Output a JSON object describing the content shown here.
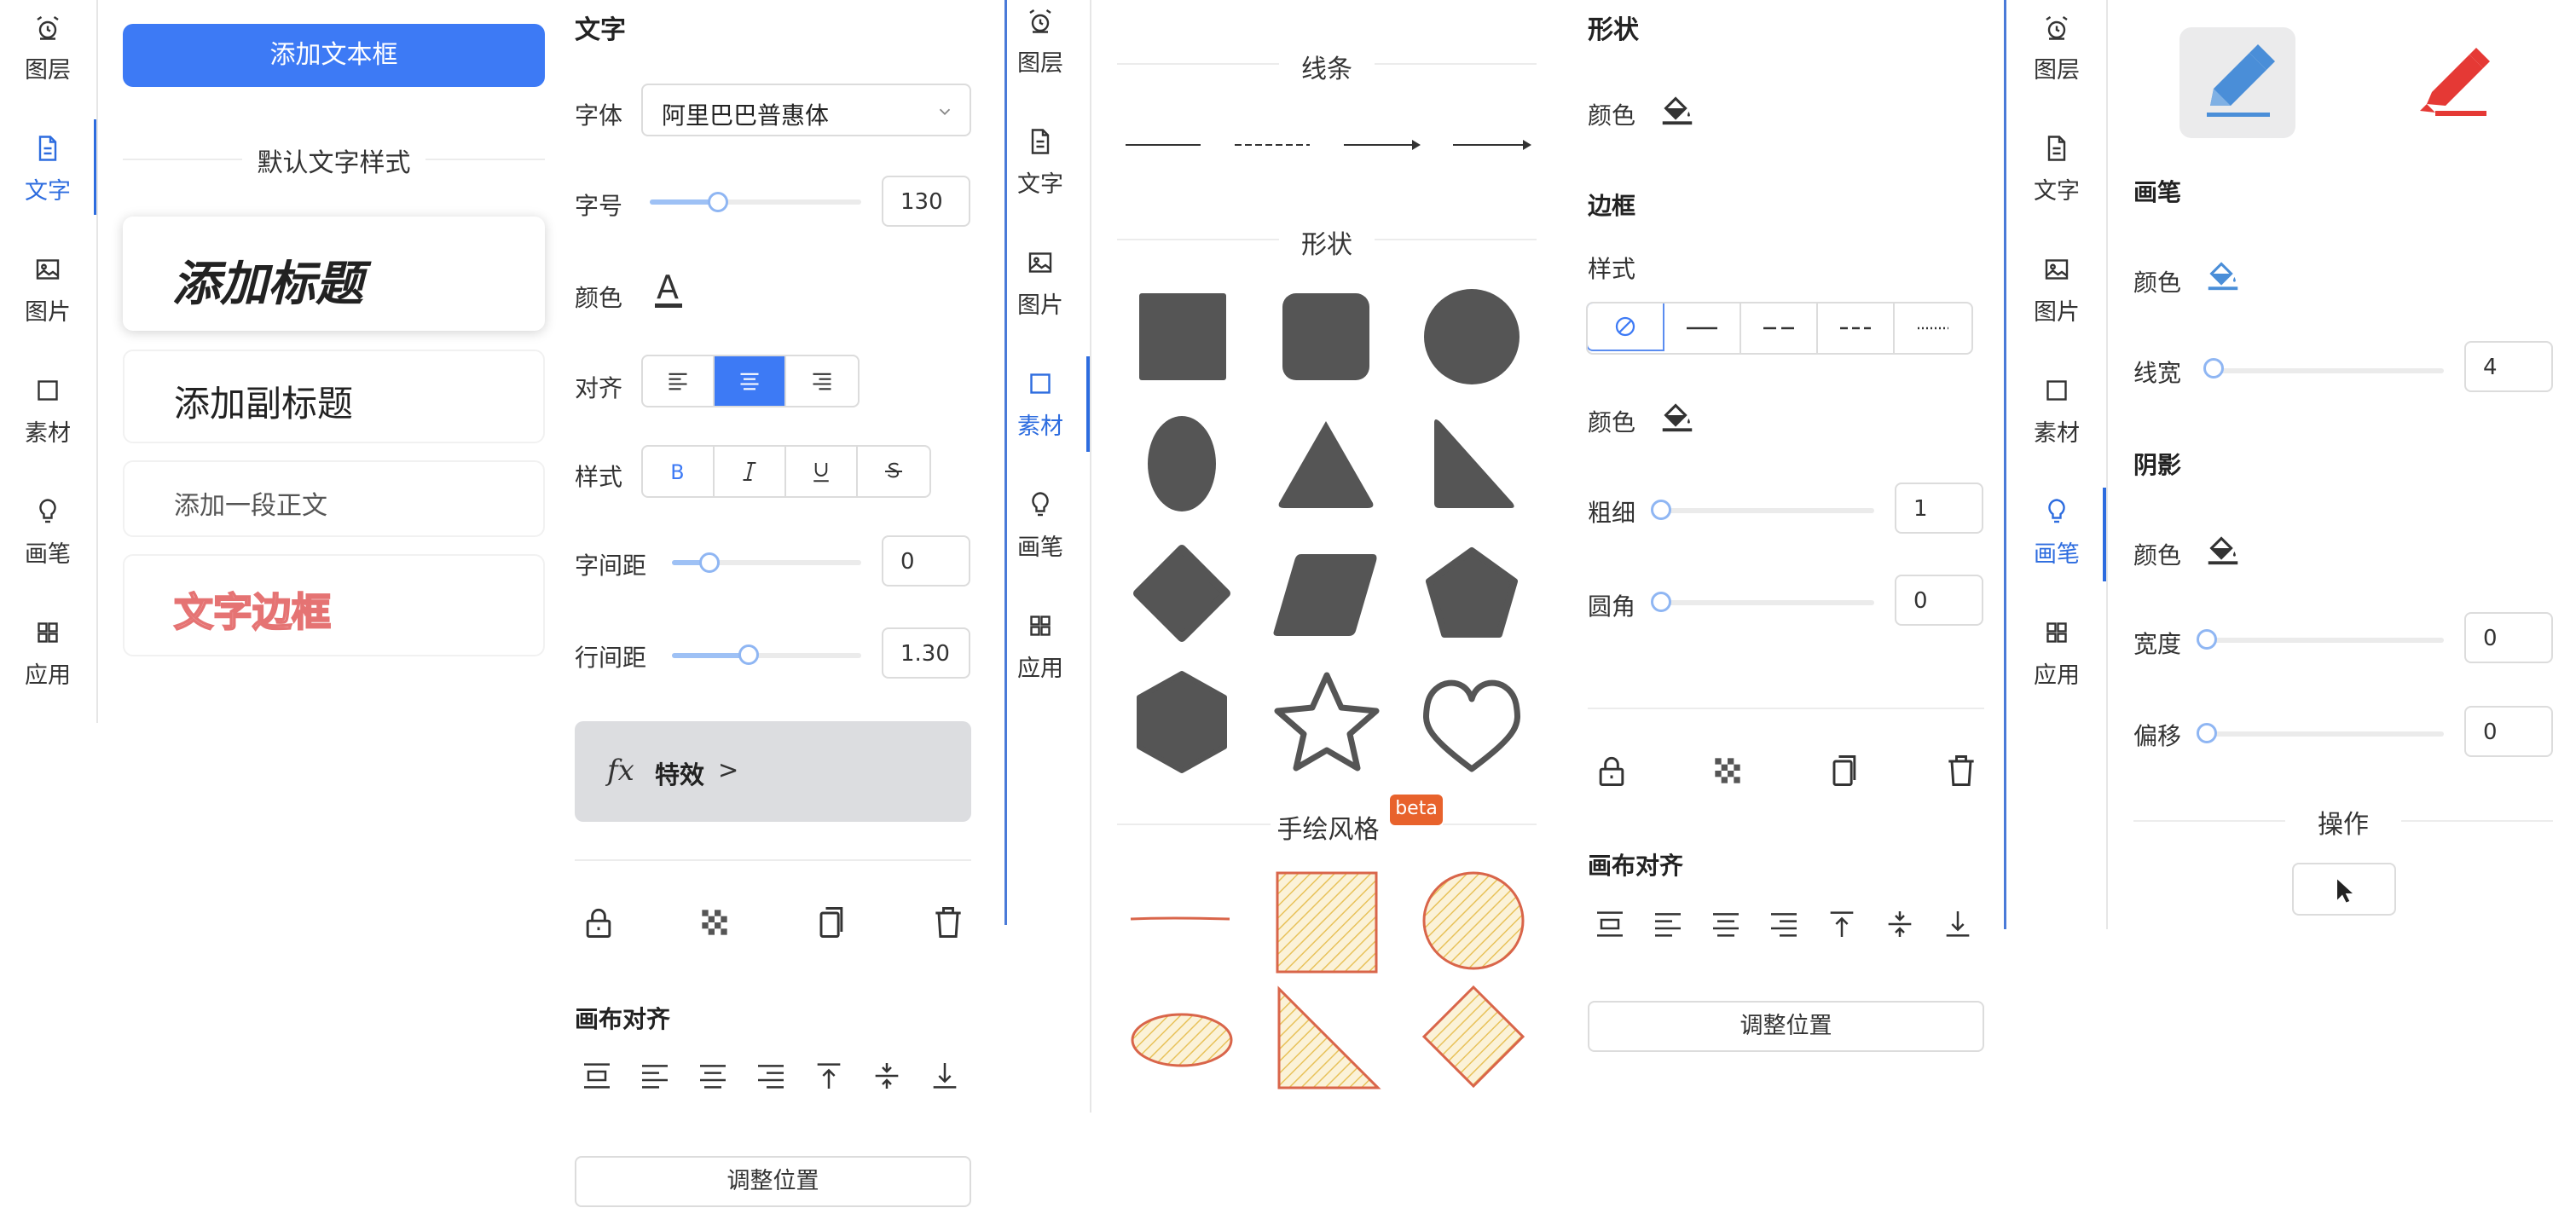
{
  "nav": {
    "items": [
      {
        "label": "图层",
        "icon": "alarm-icon"
      },
      {
        "label": "文字",
        "icon": "file-text-icon"
      },
      {
        "label": "图片",
        "icon": "image-icon"
      },
      {
        "label": "素材",
        "icon": "square-icon"
      },
      {
        "label": "画笔",
        "icon": "bulb-icon"
      },
      {
        "label": "应用",
        "icon": "apps-icon"
      }
    ]
  },
  "text_panel": {
    "add_textbox": "添加文本框",
    "default_styles": "默认文字样式",
    "add_title": "添加标题",
    "add_subtitle": "添加副标题",
    "add_body": "添加一段正文",
    "text_border": "文字边框"
  },
  "text_props": {
    "section": "文字",
    "font_label": "字体",
    "font_value": "阿里巴巴普惠体",
    "size_label": "字号",
    "size_value": "130",
    "size_fraction": 0.32,
    "color_label": "颜色",
    "align_label": "对齐",
    "style_label": "样式",
    "letter_spacing_label": "字间距",
    "letter_spacing_value": "0",
    "letter_spacing_fraction": 0.2,
    "line_height_label": "行间距",
    "line_height_value": "1.30",
    "line_height_fraction": 0.4,
    "effects_fx": "fx",
    "effects_label": "特效",
    "effects_arrow": ">",
    "canvas_align": "画布对齐",
    "adjust_position": "调整位置"
  },
  "material_panel": {
    "lines_title": "线条",
    "shapes_title": "形状",
    "handdrawn_title": "手绘风格",
    "beta": "beta"
  },
  "shape_props": {
    "section": "形状",
    "color_label": "颜色",
    "border_section": "边框",
    "style_label": "样式",
    "border_color_label": "颜色",
    "thickness_label": "粗细",
    "thickness_value": "1",
    "radius_label": "圆角",
    "radius_value": "0",
    "canvas_align": "画布对齐",
    "adjust_position": "调整位置"
  },
  "brush_props": {
    "brush_section": "画笔",
    "color_label": "颜色",
    "line_width_label": "线宽",
    "line_width_value": "4",
    "shadow_section": "阴影",
    "shadow_color_label": "颜色",
    "width_label": "宽度",
    "width_value": "0",
    "offset_label": "偏移",
    "offset_value": "0",
    "operation_title": "操作"
  },
  "colors": {
    "accent": "#3d7af5",
    "shape_fill": "#555555",
    "handdrawn_stroke": "#d9654a",
    "handdrawn_fill": "#f3d98a",
    "beta_badge": "#e8622c",
    "text_border_red": "#e57373"
  }
}
